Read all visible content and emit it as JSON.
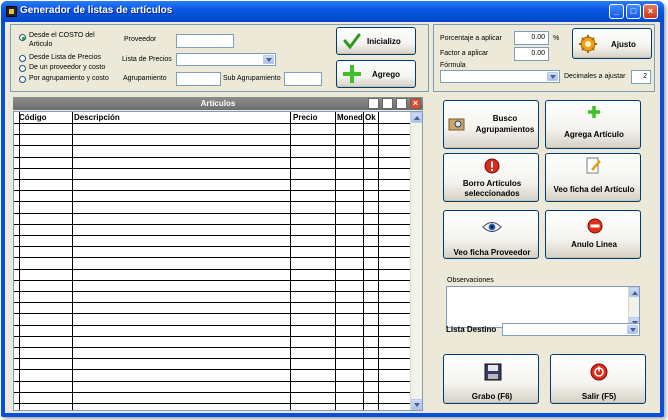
{
  "window": {
    "title": "Generador de listas de artículos"
  },
  "source_options": [
    {
      "label": "Desde el COSTO del",
      "label2": "Articulo",
      "selected": true
    },
    {
      "label": "Desde Lista de Precios",
      "selected": false
    },
    {
      "label": "De un proveedor y costo",
      "selected": false
    },
    {
      "label": "Por agrupamiento y costo",
      "selected": false
    }
  ],
  "filters": {
    "proveedor_label": "Proveedor",
    "proveedor_value": "",
    "lista_precios_label": "Lista de Precios",
    "lista_precios_value": "",
    "agrupamiento_label": "Agrupamiento",
    "agrupamiento_value": "",
    "sub_agrupamiento_label": "Sub Agrupamiento",
    "sub_agrupamiento_value": ""
  },
  "actions_top": {
    "inicializo_label": "Inicializo",
    "agrego_label": "Agrego"
  },
  "adjust": {
    "porcentaje_label": "Porcentaje a aplicar",
    "porcentaje_value": "0.00",
    "percent_symbol": "%",
    "factor_label": "Factor a aplicar",
    "factor_value": "0.00",
    "formula_label": "Fórmula",
    "formula_value": "",
    "decimales_label": "Decimales a ajustar",
    "decimales_value": "2",
    "ajusto_label": "Ajusto"
  },
  "grid": {
    "title": "Artículos",
    "columns": [
      "Código",
      "Descripción",
      "Precio",
      "Moneda",
      "Ok"
    ],
    "rows": []
  },
  "actions_side": {
    "busco_agrupamientos": [
      "Busco",
      "Agrupamientos"
    ],
    "agrega_articulo": "Agrega  Artículo",
    "borro_articulos": [
      "Borro Artículos",
      "seleccionados"
    ],
    "veo_ficha_articulo": "Veo ficha del  Artículo",
    "veo_ficha_proveedor": "Veo ficha Proveedor",
    "anulo_linea": "Anulo Linea"
  },
  "observaciones_label": "Observaciones",
  "observaciones_value": "",
  "lista_destino_label": "Lista Destino",
  "lista_destino_value": "",
  "footer": {
    "grabo_label": "Grabo (F6)",
    "salir_label": "Salir (F5)"
  }
}
